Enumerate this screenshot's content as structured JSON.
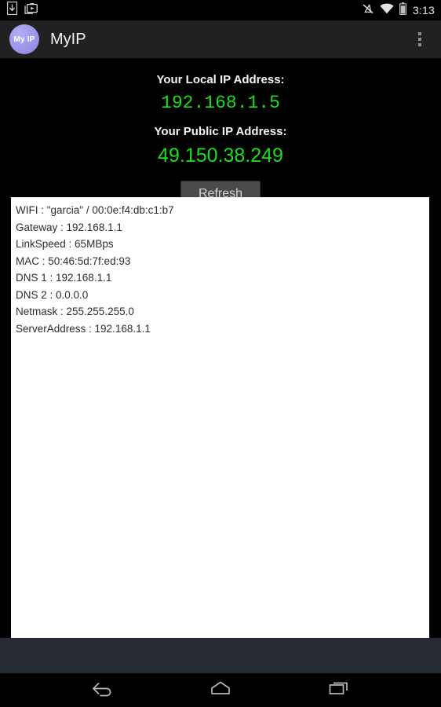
{
  "status_bar": {
    "left_icons": [
      {
        "name": "download-icon"
      },
      {
        "name": "screenshot-icon"
      }
    ],
    "right_icons": [
      {
        "name": "ringer-muted-icon"
      },
      {
        "name": "wifi-icon"
      },
      {
        "name": "battery-icon"
      }
    ],
    "clock": "3:13"
  },
  "app_bar": {
    "logo_text": "My IP",
    "title": "MyIP",
    "overflow_name": "overflow-menu-icon"
  },
  "main": {
    "local_ip_label": "Your Local IP Address:",
    "local_ip_value": "192.168.1.5",
    "public_ip_label": "Your Public IP Address:",
    "public_ip_value": "49.150.38.249",
    "refresh_label": "Refresh"
  },
  "info_panel": {
    "lines": [
      "WIFI : \"garcia\" / 00:0e:f4:db:c1:b7",
      "Gateway : 192.168.1.1",
      "LinkSpeed : 65MBps",
      "MAC : 50:46:5d:7f:ed:93",
      "DNS 1 : 192.168.1.1",
      "DNS 2 : 0.0.0.0",
      "Netmask : 255.255.255.0",
      "ServerAddress : 192.168.1.1"
    ]
  },
  "nav_bar": {
    "back_label": "Back",
    "home_label": "Home",
    "recents_label": "Recent apps"
  },
  "colors": {
    "ip_green": "#17e017",
    "app_bar": "#212121",
    "logo_purple": "#9a96ea",
    "panel_white": "#ffffff",
    "filler_slate": "#262b33"
  }
}
